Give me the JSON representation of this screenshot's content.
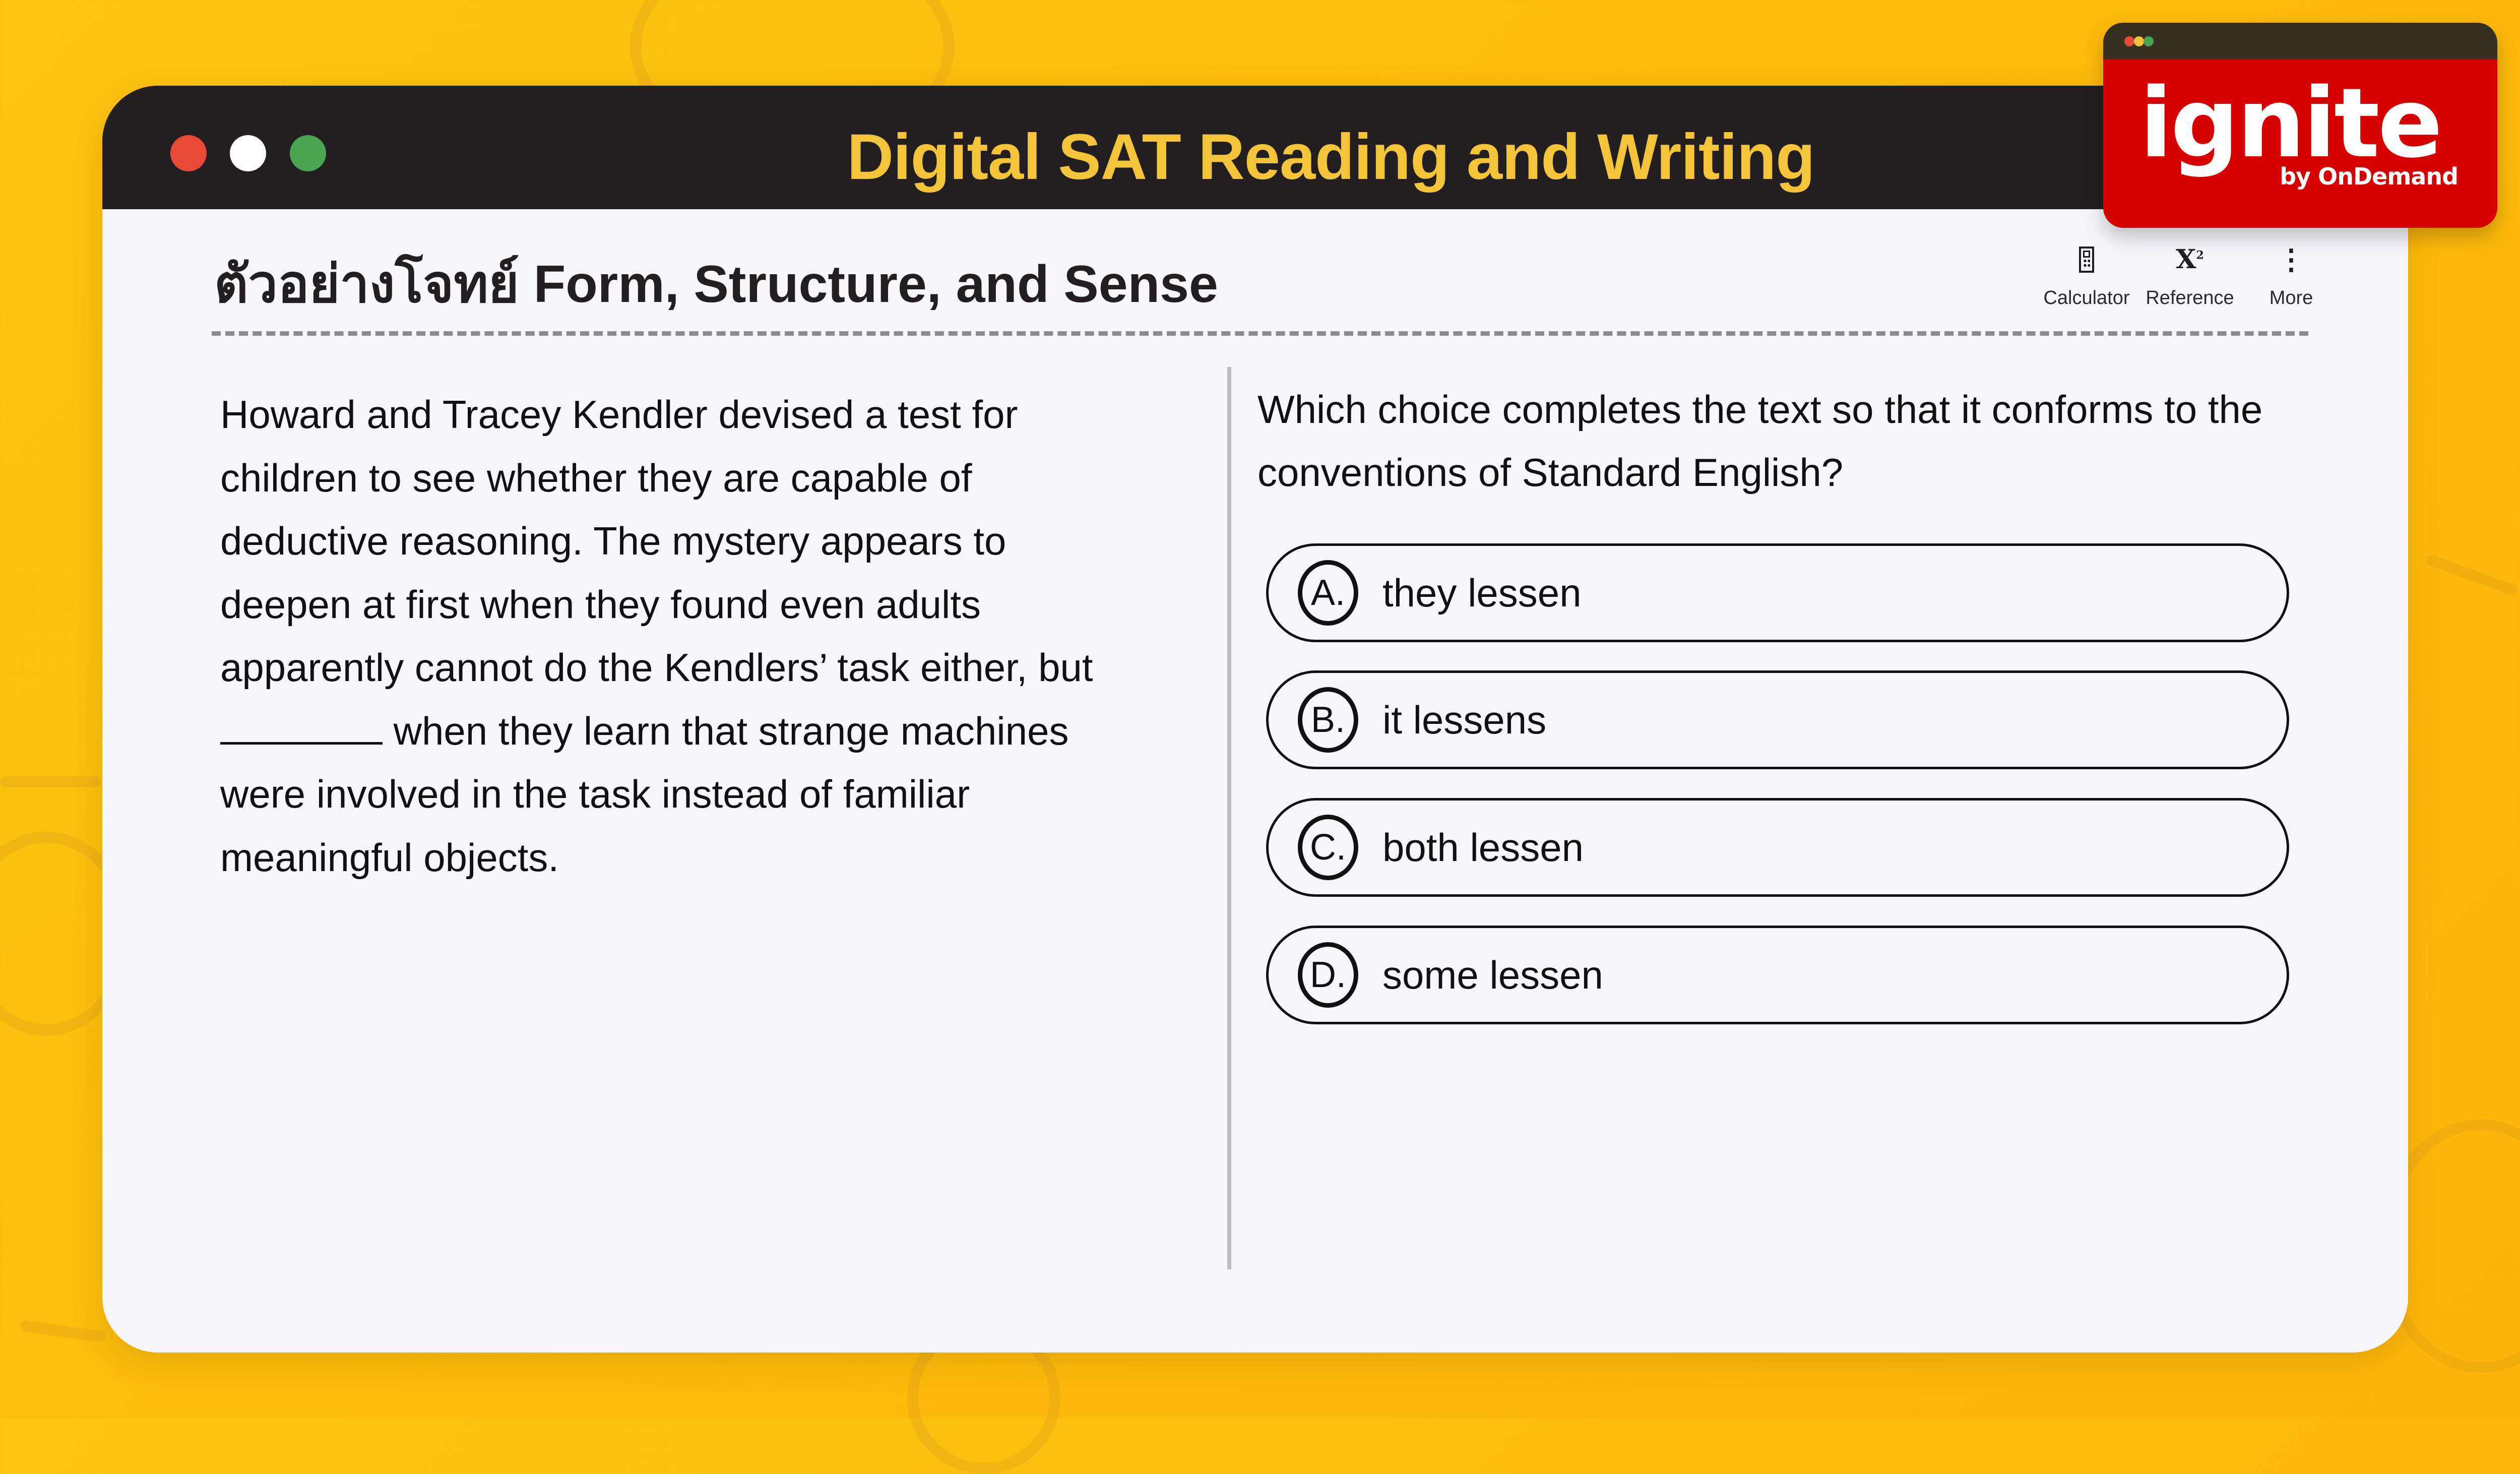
{
  "window": {
    "title": "Digital SAT Reading and Writing",
    "traffic_lights": [
      "close",
      "minimize",
      "maximize"
    ]
  },
  "colors": {
    "background": "#fcc30f",
    "title_text": "#f3c43a",
    "titlebar": "#231f20",
    "logo_card": "#d60000"
  },
  "heading": "ตัวอย่างโจทย์ Form, Structure, and Sense",
  "toolbar": {
    "calculator": {
      "label": "Calculator",
      "icon": "calculator-icon"
    },
    "reference": {
      "label": "Reference",
      "icon": "x-squared-icon",
      "glyph": "X",
      "superscript": "2"
    },
    "more": {
      "label": "More",
      "icon": "vertical-ellipsis-icon",
      "glyph": "⋮"
    }
  },
  "passage": {
    "lines": [
      "Howard and Tracey Kendler devised a test for",
      "children to see whether they are capable of",
      "deductive reasoning. The mystery appears to",
      "deepen at first when they found even adults",
      "apparently cannot do the Kendlers’ task either, but"
    ],
    "blank_line_after": "when they learn that strange machines",
    "lines_after": [
      "were involved in the task instead of familiar",
      "meaningful objects."
    ]
  },
  "question": {
    "text": "Which choice completes the text so that it conforms to the conventions of Standard English?"
  },
  "options": [
    {
      "letter": "A.",
      "text": "they lessen"
    },
    {
      "letter": "B.",
      "text": "it lessens"
    },
    {
      "letter": "C.",
      "text": "both lessen"
    },
    {
      "letter": "D.",
      "text": "some lessen"
    }
  ],
  "logo": {
    "brand": "ignite",
    "tagline": "by OnDemand"
  }
}
